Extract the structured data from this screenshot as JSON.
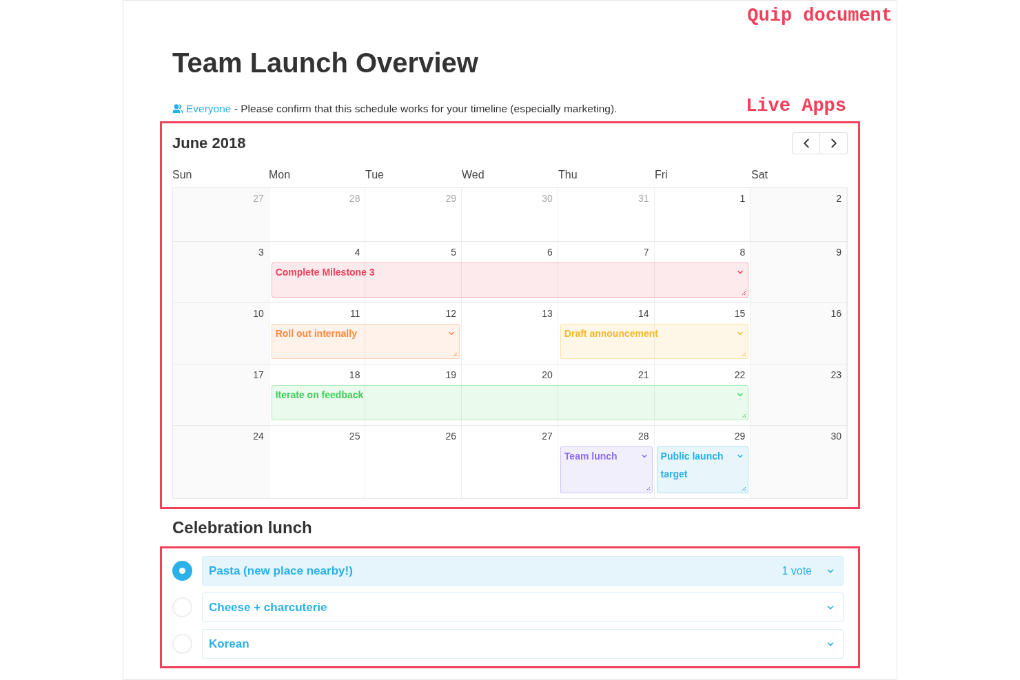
{
  "annotations": [
    {
      "kind": "document",
      "text": "Quip document"
    },
    {
      "kind": "apps",
      "text": "Live Apps"
    }
  ],
  "title": "Team Launch Overview",
  "mention": {
    "name": "Everyone",
    "text": " - Please confirm that this schedule works for your timeline (especially marketing)."
  },
  "calendar": {
    "month": "June 2018",
    "weekdays": [
      "Sun",
      "Mon",
      "Tue",
      "Wed",
      "Thu",
      "Fri",
      "Sat"
    ],
    "weeks": [
      {
        "days": [
          {
            "label": "27",
            "muted": true
          },
          {
            "label": "28",
            "muted": true
          },
          {
            "label": "29",
            "muted": true
          },
          {
            "label": "30",
            "muted": true
          },
          {
            "label": "31",
            "muted": true
          },
          {
            "label": "1",
            "muted": false
          },
          {
            "label": "2",
            "muted": false
          }
        ]
      },
      {
        "days": [
          {
            "label": "3",
            "muted": false
          },
          {
            "label": "4",
            "muted": false,
            "event": {
              "title": "Complete Milestone 3",
              "color": "#f0405a"
            }
          },
          {
            "label": "5",
            "muted": false,
            "continues": true
          },
          {
            "label": "6",
            "muted": false,
            "continues": true
          },
          {
            "label": "7",
            "muted": false,
            "continues": true
          },
          {
            "label": "8",
            "muted": false,
            "continues": true
          },
          {
            "label": "9",
            "muted": false
          }
        ]
      },
      {
        "days": [
          {
            "label": "10",
            "muted": false
          },
          {
            "label": "11",
            "muted": false,
            "event": {
              "title": "Roll out internally",
              "color": "#ff8a3d"
            }
          },
          {
            "label": "12",
            "muted": false,
            "continues": true
          },
          {
            "label": "13",
            "muted": false
          },
          {
            "label": "14",
            "muted": false,
            "event": {
              "title": "Draft announcement",
              "color": "#f5b82e"
            }
          },
          {
            "label": "15",
            "muted": false,
            "continues": true
          },
          {
            "label": "16",
            "muted": false
          }
        ]
      },
      {
        "days": [
          {
            "label": "17",
            "muted": false
          },
          {
            "label": "18",
            "muted": false,
            "event": {
              "title": "Iterate on feedback",
              "color": "#3ccf5a"
            }
          },
          {
            "label": "19",
            "muted": false,
            "continues": true
          },
          {
            "label": "20",
            "muted": false,
            "continues": true
          },
          {
            "label": "21",
            "muted": false,
            "continues": true
          },
          {
            "label": "22",
            "muted": false,
            "continues": true
          },
          {
            "label": "23",
            "muted": false
          }
        ]
      },
      {
        "days": [
          {
            "label": "24",
            "muted": false
          },
          {
            "label": "25",
            "muted": false
          },
          {
            "label": "26",
            "muted": false
          },
          {
            "label": "27",
            "muted": false
          },
          {
            "label": "28",
            "muted": false,
            "event": {
              "title": "Team lunch",
              "color": "#8c6cf0"
            }
          },
          {
            "label": "29",
            "muted": false,
            "event": {
              "title": "Public launch target",
              "color": "#2bb0e8"
            }
          },
          {
            "label": "30",
            "muted": false
          }
        ]
      }
    ]
  },
  "poll": {
    "title": "Celebration lunch",
    "options": [
      {
        "label": "Pasta (new place nearby!)",
        "selected": true,
        "votes": "1 vote"
      },
      {
        "label": "Cheese + charcuterie",
        "selected": false
      },
      {
        "label": "Korean",
        "selected": false
      }
    ]
  }
}
